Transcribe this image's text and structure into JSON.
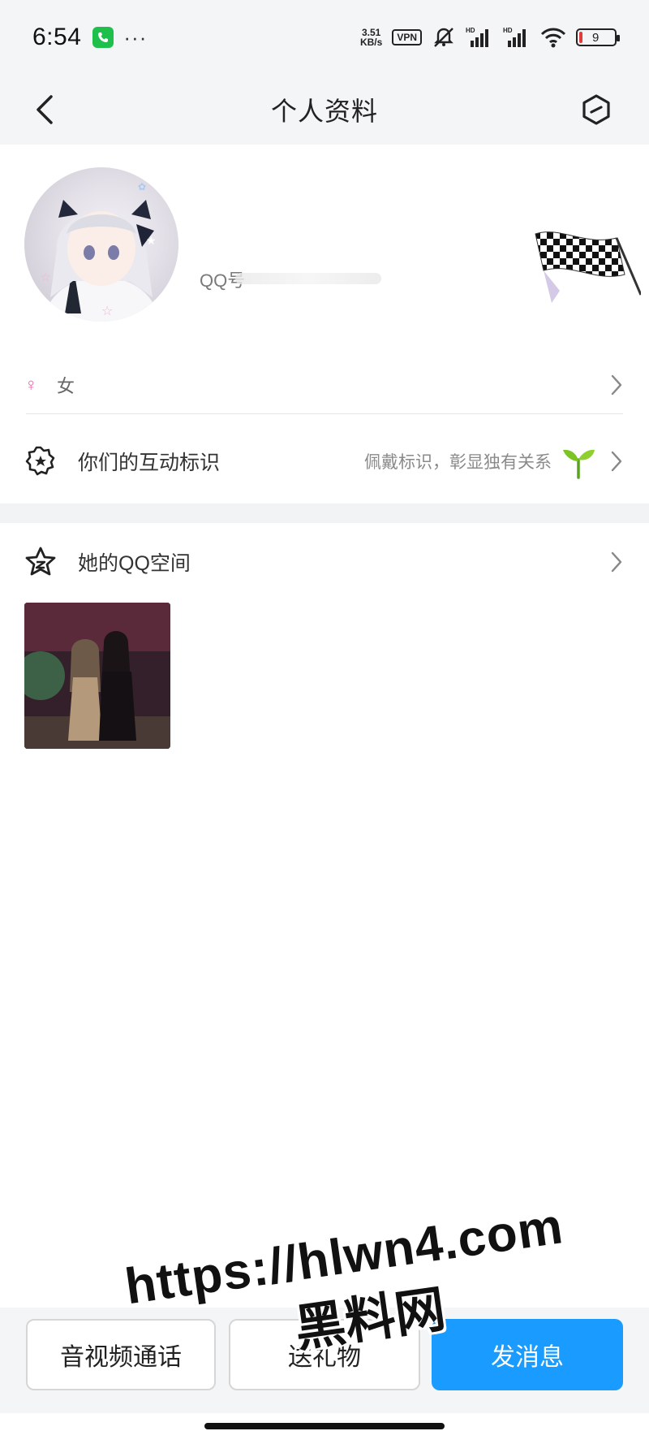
{
  "status_bar": {
    "time": "6:54",
    "more": "···",
    "net_speed_value": "3.51",
    "net_speed_unit": "KB/s",
    "vpn": "VPN",
    "battery": "9",
    "signal_label": "HD"
  },
  "header": {
    "title": "个人资料"
  },
  "profile": {
    "qq_prefix": "QQ号"
  },
  "gender": {
    "label": "女",
    "icon": "female-icon"
  },
  "interaction": {
    "title": "你们的互动标识",
    "hint": "佩戴标识，彰显独有关系"
  },
  "qzone": {
    "title": "她的QQ空间"
  },
  "bottom_bar": {
    "call": "音视频通话",
    "gift": "送礼物",
    "message": "发消息"
  },
  "watermark": {
    "line1": "https://hlwn4.com",
    "line2": "黑料网"
  },
  "colors": {
    "primary": "#1a9bff",
    "female": "#e667a7",
    "sprout": "#7cc324"
  }
}
